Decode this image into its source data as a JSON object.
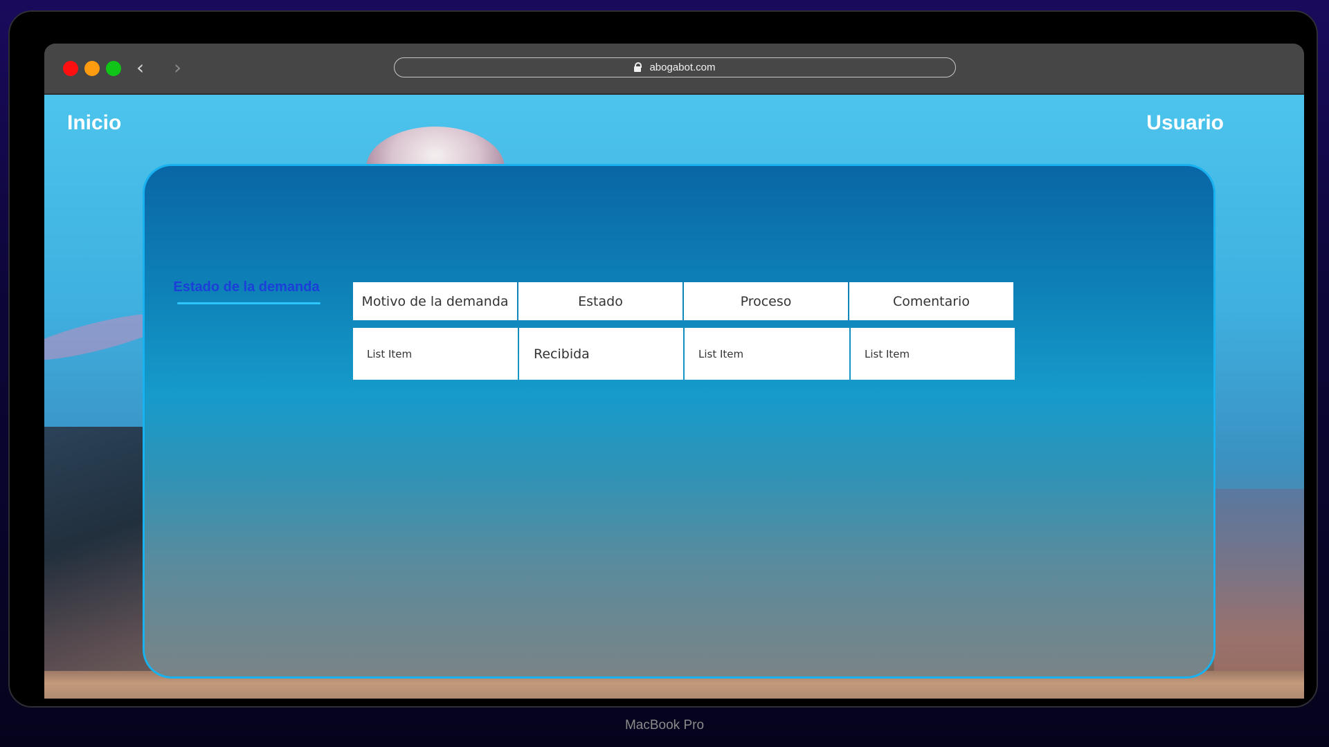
{
  "device": {
    "caption": "MacBook Pro"
  },
  "browser": {
    "url": "abogabot.com",
    "back_icon": "‹",
    "forward_icon": "›"
  },
  "site": {
    "nav_left": "Inicio",
    "nav_right": "Usuario",
    "side_tab": "Estado de la demanda",
    "table": {
      "headers": [
        "Motivo de la demanda",
        "Estado",
        "Proceso",
        "Comentario"
      ],
      "row": [
        "List Item",
        "Recibida",
        "List Item",
        "List Item"
      ]
    }
  },
  "colors": {
    "panel_border": "#18b2f0",
    "side_tab_text": "#1b3fd8",
    "side_tab_underline": "#2ec6ff"
  }
}
